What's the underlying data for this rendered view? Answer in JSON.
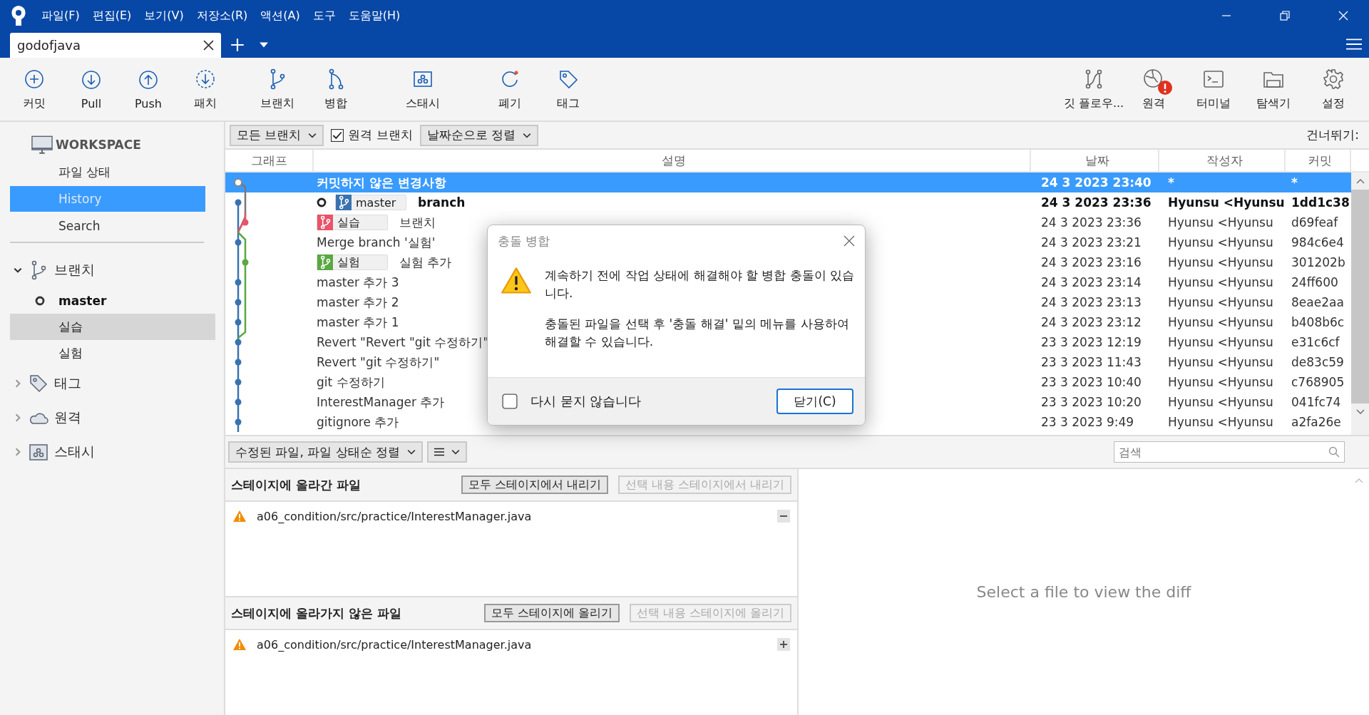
{
  "window": {
    "menu": [
      "파일(F)",
      "편집(E)",
      "보기(V)",
      "저장소(R)",
      "액션(A)",
      "도구",
      "도움말(H)"
    ]
  },
  "tabs": [
    {
      "label": "godofjava",
      "selected": true
    }
  ],
  "toolbar": {
    "left": [
      {
        "label": "커밋"
      },
      {
        "label": "Pull"
      },
      {
        "label": "Push"
      },
      {
        "label": "패치"
      },
      {
        "label": "브랜치"
      },
      {
        "label": "병합"
      },
      {
        "label": "스태시"
      },
      {
        "label": "폐기"
      },
      {
        "label": "태그"
      }
    ],
    "right": [
      {
        "label": "깃 플로우..."
      },
      {
        "label": "원격"
      },
      {
        "label": "터미널"
      },
      {
        "label": "탐색기"
      },
      {
        "label": "설정"
      }
    ]
  },
  "sidebar": {
    "workspace": {
      "title": "WORKSPACE",
      "items": [
        {
          "label": "파일 상태",
          "selected": false
        },
        {
          "label": "History",
          "selected": true
        },
        {
          "label": "Search",
          "selected": false
        }
      ]
    },
    "sections": [
      {
        "title": "브랜치",
        "expanded": true,
        "items": [
          {
            "label": "master",
            "current": true,
            "selected": false
          },
          {
            "label": "실습",
            "current": false,
            "selected": true
          },
          {
            "label": "실험",
            "current": false,
            "selected": false
          }
        ]
      },
      {
        "title": "태그",
        "expanded": false
      },
      {
        "title": "원격",
        "expanded": false
      },
      {
        "title": "스태시",
        "expanded": false
      }
    ]
  },
  "filter_bar": {
    "branch_filter": "모든 브랜치",
    "remote_branches": {
      "label": "원격 브랜치",
      "checked": true
    },
    "sort": "날짜순으로 정렬",
    "jump_label": "건너뛰기:"
  },
  "commits": {
    "columns": [
      "그래프",
      "설명",
      "날짜",
      "작성자",
      "커밋"
    ],
    "rows": [
      {
        "kind": "uncommitted",
        "selected": true,
        "head": false,
        "refs": [],
        "description": "커밋하지 않은 변경사항",
        "date": "24 3 2023 23:40",
        "author": "*",
        "commit": "*"
      },
      {
        "kind": "commit",
        "selected": false,
        "head": true,
        "refs": [
          {
            "label": "master",
            "color": "#3a72b0"
          }
        ],
        "description": "branch",
        "date": "24 3 2023 23:36",
        "author": "Hyunsu <Hyunsu",
        "commit": "1dd1c38"
      },
      {
        "kind": "commit",
        "selected": false,
        "head": false,
        "refs": [
          {
            "label": "실습",
            "color": "#e8546a"
          }
        ],
        "description": "브랜치",
        "date": "24 3 2023 23:36",
        "author": "Hyunsu <Hyunsu",
        "commit": "d69feaf"
      },
      {
        "kind": "commit",
        "selected": false,
        "head": false,
        "refs": [],
        "description": "Merge branch '실험'",
        "date": "24 3 2023 23:21",
        "author": "Hyunsu <Hyunsu",
        "commit": "984c6e4"
      },
      {
        "kind": "commit",
        "selected": false,
        "head": false,
        "refs": [
          {
            "label": "실험",
            "color": "#5aa842"
          }
        ],
        "description": "실험 추가",
        "date": "24 3 2023 23:16",
        "author": "Hyunsu <Hyunsu",
        "commit": "301202b"
      },
      {
        "kind": "commit",
        "selected": false,
        "head": false,
        "refs": [],
        "description": "master 추가 3",
        "date": "24 3 2023 23:14",
        "author": "Hyunsu <Hyunsu",
        "commit": "24ff600"
      },
      {
        "kind": "commit",
        "selected": false,
        "head": false,
        "refs": [],
        "description": "master 추가 2",
        "date": "24 3 2023 23:13",
        "author": "Hyunsu <Hyunsu",
        "commit": "8eae2aa"
      },
      {
        "kind": "commit",
        "selected": false,
        "head": false,
        "refs": [],
        "description": "master 추가 1",
        "date": "24 3 2023 23:12",
        "author": "Hyunsu <Hyunsu",
        "commit": "b408b6c"
      },
      {
        "kind": "commit",
        "selected": false,
        "head": false,
        "refs": [],
        "description": "Revert \"Revert \"git 수정하기\"",
        "date": "23 3 2023 12:19",
        "author": "Hyunsu <Hyunsu",
        "commit": "e31c6cf"
      },
      {
        "kind": "commit",
        "selected": false,
        "head": false,
        "refs": [],
        "description": "Revert \"git 수정하기\"",
        "date": "23 3 2023 11:43",
        "author": "Hyunsu <Hyunsu",
        "commit": "de83c59"
      },
      {
        "kind": "commit",
        "selected": false,
        "head": false,
        "refs": [],
        "description": "git 수정하기",
        "date": "23 3 2023 10:40",
        "author": "Hyunsu <Hyunsu",
        "commit": "c768905"
      },
      {
        "kind": "commit",
        "selected": false,
        "head": false,
        "refs": [],
        "description": "InterestManager 추가",
        "date": "23 3 2023 10:20",
        "author": "Hyunsu <Hyunsu",
        "commit": "041fc74"
      },
      {
        "kind": "commit",
        "selected": false,
        "head": false,
        "refs": [],
        "description": "gitignore 추가",
        "date": "23 3 2023 9:49",
        "author": "Hyunsu <Hyunsu",
        "commit": "a2fa26e"
      }
    ]
  },
  "file_bar": {
    "sort": "수정된 파일, 파일 상태순 정렬",
    "search": {
      "placeholder": "검색"
    }
  },
  "staged": {
    "title": "스테이지에 올라간 파일",
    "buttons": [
      {
        "label": "모두 스테이지에서 내리기",
        "disabled": false
      },
      {
        "label": "선택 내용 스테이지에서 내리기",
        "disabled": true
      }
    ],
    "files": [
      {
        "path": "a06_condition/src/practice/InterestManager.java"
      }
    ]
  },
  "unstaged": {
    "title": "스테이지에 올라가지 않은 파일",
    "buttons": [
      {
        "label": "모두 스테이지에 올리기",
        "disabled": false
      },
      {
        "label": "선택 내용 스테이지에 올리기",
        "disabled": true
      }
    ],
    "files": [
      {
        "path": "a06_condition/src/practice/InterestManager.java"
      }
    ]
  },
  "diff": {
    "message": "Select a file to view the diff"
  },
  "dialog": {
    "title": "충돌 병합",
    "paragraphs": [
      "계속하기 전에 작업 상태에 해결해야 할 병합 충돌이 있습니다.",
      "충돌된 파일을 선택 후 '충돌 해결' 밑의 메뉴를 사용하여 해결할 수 있습니다."
    ],
    "dont_ask": {
      "label": "다시 묻지 않습니다",
      "checked": false
    },
    "button": "닫기(C)"
  }
}
